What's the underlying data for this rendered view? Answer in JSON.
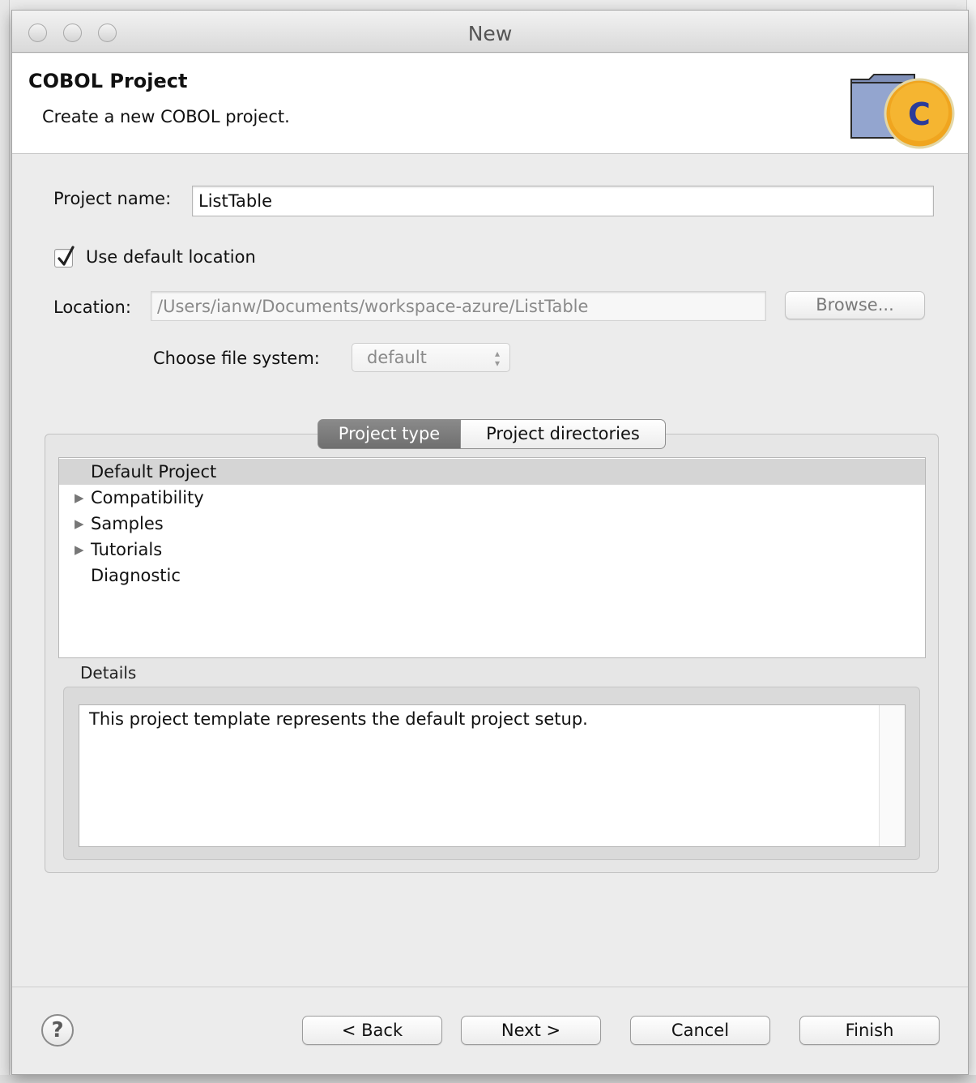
{
  "window": {
    "title": "New"
  },
  "banner": {
    "title": "COBOL Project",
    "description": "Create a new COBOL project.",
    "icon_letter": "C"
  },
  "form": {
    "project_name_label": "Project name:",
    "project_name_value": "ListTable",
    "use_default_location_label": "Use default location",
    "use_default_location_checked": true,
    "location_label": "Location:",
    "location_value": "/Users/ianw/Documents/workspace-azure/ListTable",
    "browse_label": "Browse...",
    "file_system_label": "Choose file system:",
    "file_system_value": "default"
  },
  "tabs": [
    {
      "label": "Project type",
      "active": true
    },
    {
      "label": "Project directories",
      "active": false
    }
  ],
  "project_types": [
    {
      "label": "Default Project",
      "expandable": false,
      "selected": true
    },
    {
      "label": "Compatibility",
      "expandable": true,
      "selected": false
    },
    {
      "label": "Samples",
      "expandable": true,
      "selected": false
    },
    {
      "label": "Tutorials",
      "expandable": true,
      "selected": false
    },
    {
      "label": "Diagnostic",
      "expandable": false,
      "selected": false
    }
  ],
  "details": {
    "label": "Details",
    "text": "This project template represents the default project setup."
  },
  "footer": {
    "help_label": "?",
    "back_label": "< Back",
    "next_label": "Next >",
    "cancel_label": "Cancel",
    "finish_label": "Finish"
  },
  "icons": {
    "folder_color": "#8fa1c9",
    "badge_color": "#f5b531",
    "badge_letter_color": "#2b3c9a",
    "tree_arrow": "▶"
  }
}
